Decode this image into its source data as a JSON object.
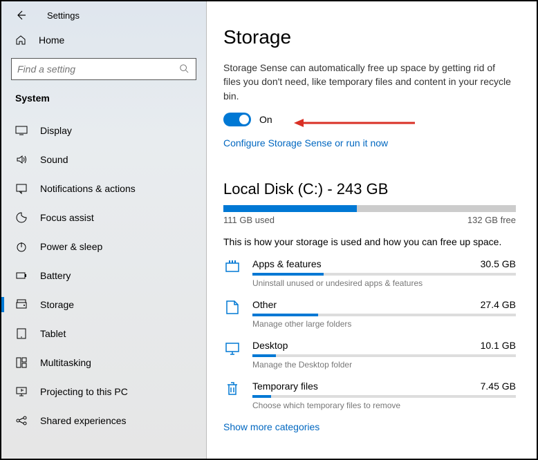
{
  "app": {
    "title": "Settings"
  },
  "sidebar": {
    "home_label": "Home",
    "search_placeholder": "Find a setting",
    "section": "System",
    "items": [
      {
        "icon": "display",
        "label": "Display"
      },
      {
        "icon": "sound",
        "label": "Sound"
      },
      {
        "icon": "notifications",
        "label": "Notifications & actions"
      },
      {
        "icon": "focus",
        "label": "Focus assist"
      },
      {
        "icon": "power",
        "label": "Power & sleep"
      },
      {
        "icon": "battery",
        "label": "Battery"
      },
      {
        "icon": "storage",
        "label": "Storage",
        "active": true
      },
      {
        "icon": "tablet",
        "label": "Tablet"
      },
      {
        "icon": "multitask",
        "label": "Multitasking"
      },
      {
        "icon": "project",
        "label": "Projecting to this PC"
      },
      {
        "icon": "shared",
        "label": "Shared experiences"
      }
    ]
  },
  "main": {
    "title": "Storage",
    "desc": "Storage Sense can automatically free up space by getting rid of files you don't need, like temporary files and content in your recycle bin.",
    "toggle": {
      "state": "On"
    },
    "configure_link": "Configure Storage Sense or run it now",
    "disk": {
      "title": "Local Disk (C:) - 243 GB",
      "used_label": "111 GB used",
      "free_label": "132 GB free",
      "fill_pct": 45.7
    },
    "usage_desc": "This is how your storage is used and how you can free up space.",
    "categories": [
      {
        "icon": "apps",
        "name": "Apps & features",
        "size": "30.5 GB",
        "sub": "Uninstall unused or undesired apps & features",
        "pct": 27
      },
      {
        "icon": "other",
        "name": "Other",
        "size": "27.4 GB",
        "sub": "Manage other large folders",
        "pct": 25
      },
      {
        "icon": "desktop",
        "name": "Desktop",
        "size": "10.1 GB",
        "sub": "Manage the Desktop folder",
        "pct": 9
      },
      {
        "icon": "temp",
        "name": "Temporary files",
        "size": "7.45 GB",
        "sub": "Choose which temporary files to remove",
        "pct": 7
      }
    ],
    "show_more": "Show more categories"
  }
}
